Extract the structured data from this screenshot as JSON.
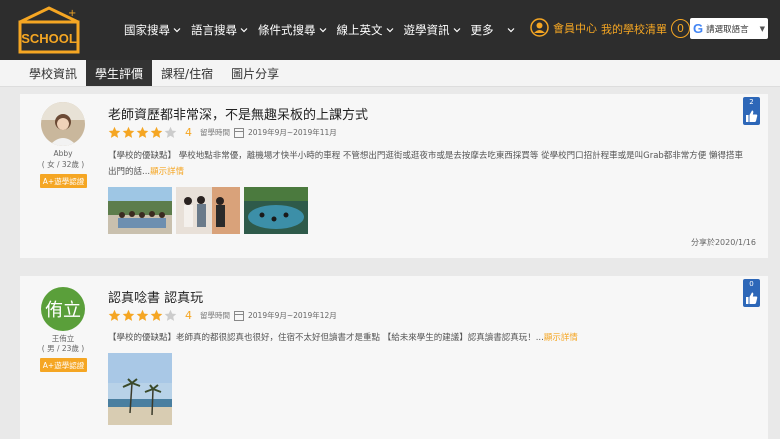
{
  "header": {
    "logo_text": "SCHOOL",
    "nav": [
      {
        "label": "國家搜尋"
      },
      {
        "label": "語言搜尋"
      },
      {
        "label": "條件式搜尋"
      },
      {
        "label": "線上英文"
      },
      {
        "label": "遊學資訊"
      },
      {
        "label": "更多"
      }
    ],
    "member_label": "會員中心",
    "mylist_label": "我的學校清單",
    "mylist_count": "0",
    "translate_label": "請選取語言"
  },
  "tabs": [
    {
      "label": "學校資訊",
      "active": false
    },
    {
      "label": "學生評價",
      "active": true
    },
    {
      "label": "課程/住宿",
      "active": false
    },
    {
      "label": "圖片分享",
      "active": false
    }
  ],
  "reviews": [
    {
      "user_name": "Abby",
      "user_info": "( 女 / 32歲 )",
      "cert": "A+遊學認證",
      "title": "老師資歷都非常深，不是無趣呆板的上課方式",
      "rating": "4",
      "stars": 4,
      "period_label": "留學時間",
      "period": "2019年9月~2019年11月",
      "body": "【學校的優缺點】 學校地點非常優，離機場才快半小時的車程 不管想出門逛街或逛夜市或是去按摩去吃東西採買等 從學校門口招計程車或是叫Grab都非常方便 懶得搭車出門的話...",
      "more": "顯示詳情",
      "shared": "分享於2020/1/16",
      "likes": "2"
    },
    {
      "user_name": "王侑立",
      "avatar_text": "侑立",
      "user_info": "( 男 / 23歲 )",
      "cert": "A+遊學認證",
      "title": "認真唸書 認真玩",
      "rating": "4",
      "stars": 4,
      "period_label": "留學時間",
      "period": "2019年9月~2019年12月",
      "body": "【學校的優缺點】老師真的都很認真也很好，住宿不太好但讀書才是重點 【給未來學生的建議】認真讀書認真玩！...",
      "more": "顯示詳情",
      "likes": "0"
    }
  ],
  "colors": {
    "accent": "#f5a623",
    "header_bg": "#2d2d2d",
    "like_blue": "#2d67b8",
    "avatar_green": "#5a9f3a"
  }
}
